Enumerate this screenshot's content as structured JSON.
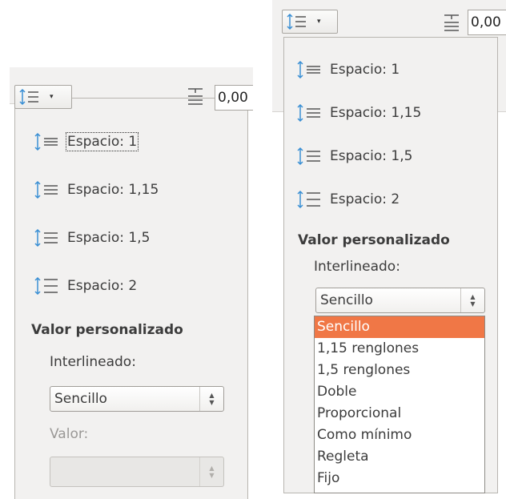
{
  "left": {
    "toolbar": {
      "dropdown_arrow": "▾",
      "spacing_value": "0,00"
    },
    "items": [
      {
        "label": "Espacio: 1"
      },
      {
        "label": "Espacio: 1,15"
      },
      {
        "label": "Espacio: 1,5"
      },
      {
        "label": "Espacio: 2"
      }
    ],
    "custom_heading": "Valor personalizado",
    "line_spacing_label": "Interlineado:",
    "line_spacing_value": "Sencillo",
    "value_label": "Valor:",
    "value_field": ""
  },
  "right": {
    "toolbar": {
      "dropdown_arrow": "▾",
      "spacing_value": "0,00"
    },
    "items": [
      {
        "label": "Espacio: 1"
      },
      {
        "label": "Espacio: 1,15"
      },
      {
        "label": "Espacio: 1,5"
      },
      {
        "label": "Espacio: 2"
      }
    ],
    "custom_heading": "Valor personalizado",
    "line_spacing_label": "Interlineado:",
    "line_spacing_value": "Sencillo",
    "dropdown_options": [
      "Sencillo",
      "1,15 renglones",
      "1,5 renglones",
      "Doble",
      "Proporcional",
      "Como mínimo",
      "Regleta",
      "Fijo"
    ],
    "selected_option": "Sencillo"
  },
  "colors": {
    "selection": "#f07746",
    "panel_bg": "#f2f1f0",
    "icon_blue": "#3a8fd4"
  }
}
